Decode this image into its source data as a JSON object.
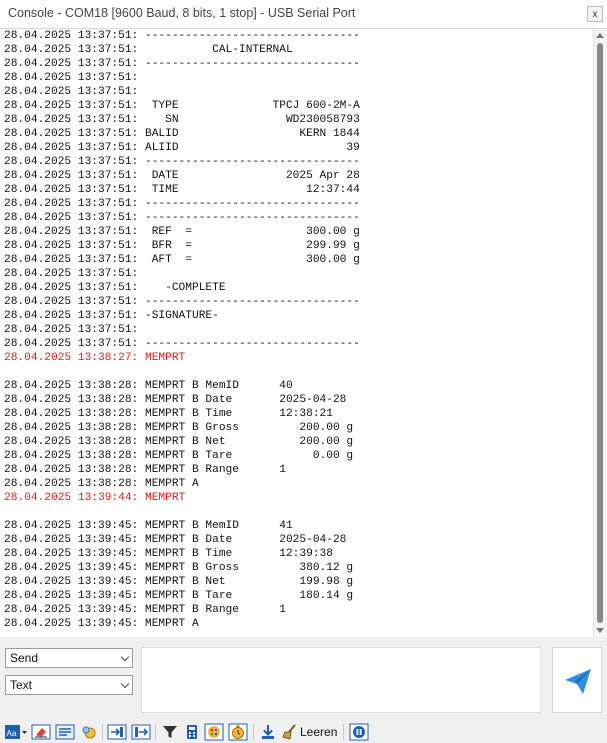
{
  "window": {
    "title": "Console - COM18 [9600 Baud, 8 bits, 1 stop] - USB Serial Port",
    "close_label": "x"
  },
  "console": {
    "lines": [
      {
        "text": "28.04.2025 13:37:51: --------------------------------",
        "color": "normal"
      },
      {
        "text": "28.04.2025 13:37:51:           CAL-INTERNAL",
        "color": "normal"
      },
      {
        "text": "28.04.2025 13:37:51: --------------------------------",
        "color": "normal"
      },
      {
        "text": "28.04.2025 13:37:51:",
        "color": "normal"
      },
      {
        "text": "28.04.2025 13:37:51:",
        "color": "normal"
      },
      {
        "text": "28.04.2025 13:37:51:  TYPE              TPCJ 600-2M-A",
        "color": "normal"
      },
      {
        "text": "28.04.2025 13:37:51:    SN                WD230058793",
        "color": "normal"
      },
      {
        "text": "28.04.2025 13:37:51: BALID                  KERN 1844",
        "color": "normal"
      },
      {
        "text": "28.04.2025 13:37:51: ALIID                         39",
        "color": "normal"
      },
      {
        "text": "28.04.2025 13:37:51: --------------------------------",
        "color": "normal"
      },
      {
        "text": "28.04.2025 13:37:51:  DATE                2025 Apr 28",
        "color": "normal"
      },
      {
        "text": "28.04.2025 13:37:51:  TIME                   12:37:44",
        "color": "normal"
      },
      {
        "text": "28.04.2025 13:37:51: --------------------------------",
        "color": "normal"
      },
      {
        "text": "28.04.2025 13:37:51: --------------------------------",
        "color": "normal"
      },
      {
        "text": "28.04.2025 13:37:51:  REF  =                 300.00 g",
        "color": "normal"
      },
      {
        "text": "28.04.2025 13:37:51:  BFR  =                 299.99 g",
        "color": "normal"
      },
      {
        "text": "28.04.2025 13:37:51:  AFT  =                 300.00 g",
        "color": "normal"
      },
      {
        "text": "28.04.2025 13:37:51:",
        "color": "normal"
      },
      {
        "text": "28.04.2025 13:37:51:    -COMPLETE",
        "color": "normal"
      },
      {
        "text": "28.04.2025 13:37:51: --------------------------------",
        "color": "normal"
      },
      {
        "text": "28.04.2025 13:37:51: -SIGNATURE-",
        "color": "normal"
      },
      {
        "text": "28.04.2025 13:37:51:",
        "color": "normal"
      },
      {
        "text": "28.04.2025 13:37:51: --------------------------------",
        "color": "normal"
      },
      {
        "text": "28.04.2025 13:38:27: MEMPRT",
        "color": "red"
      },
      {
        "text": "",
        "color": "normal"
      },
      {
        "text": "28.04.2025 13:38:28: MEMPRT B MemID      40",
        "color": "normal"
      },
      {
        "text": "28.04.2025 13:38:28: MEMPRT B Date       2025-04-28",
        "color": "normal"
      },
      {
        "text": "28.04.2025 13:38:28: MEMPRT B Time       12:38:21",
        "color": "normal"
      },
      {
        "text": "28.04.2025 13:38:28: MEMPRT B Gross         200.00 g",
        "color": "normal"
      },
      {
        "text": "28.04.2025 13:38:28: MEMPRT B Net           200.00 g",
        "color": "normal"
      },
      {
        "text": "28.04.2025 13:38:28: MEMPRT B Tare            0.00 g",
        "color": "normal"
      },
      {
        "text": "28.04.2025 13:38:28: MEMPRT B Range      1",
        "color": "normal"
      },
      {
        "text": "28.04.2025 13:38:28: MEMPRT A",
        "color": "normal"
      },
      {
        "text": "28.04.2025 13:39:44: MEMPRT",
        "color": "red"
      },
      {
        "text": "",
        "color": "normal"
      },
      {
        "text": "28.04.2025 13:39:45: MEMPRT B MemID      41",
        "color": "normal"
      },
      {
        "text": "28.04.2025 13:39:45: MEMPRT B Date       2025-04-28",
        "color": "normal"
      },
      {
        "text": "28.04.2025 13:39:45: MEMPRT B Time       12:39:38",
        "color": "normal"
      },
      {
        "text": "28.04.2025 13:39:45: MEMPRT B Gross         380.12 g",
        "color": "normal"
      },
      {
        "text": "28.04.2025 13:39:45: MEMPRT B Net           199.98 g",
        "color": "normal"
      },
      {
        "text": "28.04.2025 13:39:45: MEMPRT B Tare          180.14 g",
        "color": "normal"
      },
      {
        "text": "28.04.2025 13:39:45: MEMPRT B Range      1",
        "color": "normal"
      },
      {
        "text": "28.04.2025 13:39:45: MEMPRT A",
        "color": "normal"
      }
    ]
  },
  "send_panel": {
    "mode_select": "Send",
    "format_select": "Text",
    "input_value": "",
    "send_icon": "paper-plane-icon"
  },
  "toolbar": {
    "clear_label": "Leeren",
    "icons": [
      "font-size-icon",
      "eraser-icon",
      "word-wrap-icon",
      "settings-icon",
      "import-icon",
      "export-icon",
      "filter-icon",
      "calculator-icon",
      "color-palette-icon",
      "timer-icon",
      "download-icon",
      "broom-icon",
      "pause-icon"
    ]
  },
  "colors": {
    "log_red": "#dd1c1c",
    "send_icon": "#2f8fe0",
    "accent_blue": "#1f5fb0"
  }
}
